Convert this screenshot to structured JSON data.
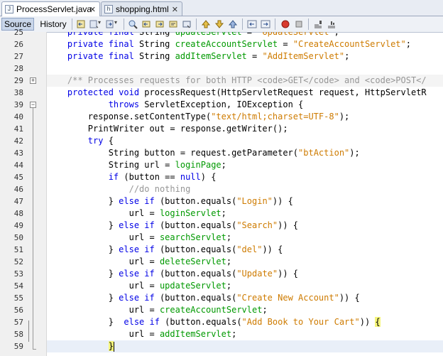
{
  "tabs": [
    {
      "label": "ProcessServlet.java",
      "icon": "java-file-icon",
      "active": true
    },
    {
      "label": "shopping.html",
      "icon": "html-file-icon",
      "active": false
    }
  ],
  "toolbar": {
    "source_label": "Source",
    "history_label": "History",
    "icons": [
      "last-edit-icon",
      "back-icon",
      "forward-icon",
      "find-icon",
      "find-previous-icon",
      "find-next-icon",
      "toggle-highlight-icon",
      "toggle-rect-select-icon",
      "previous-bookmark-icon",
      "next-bookmark-icon",
      "toggle-bookmark-icon",
      "shift-left-icon",
      "shift-right-icon",
      "start-macro-icon",
      "stop-macro-icon",
      "comment-icon",
      "uncomment-icon"
    ]
  },
  "editor": {
    "line_numbers": [
      "25",
      "26",
      "27",
      "28",
      "29",
      "38",
      "39",
      "40",
      "41",
      "42",
      "43",
      "44",
      "45",
      "46",
      "47",
      "48",
      "49",
      "50",
      "51",
      "52",
      "53",
      "54",
      "55",
      "56",
      "57",
      "58",
      "59"
    ],
    "colors": {
      "keyword": "#0000e6",
      "string": "#ce7b00",
      "field": "#009900",
      "comment": "#969696"
    }
  }
}
